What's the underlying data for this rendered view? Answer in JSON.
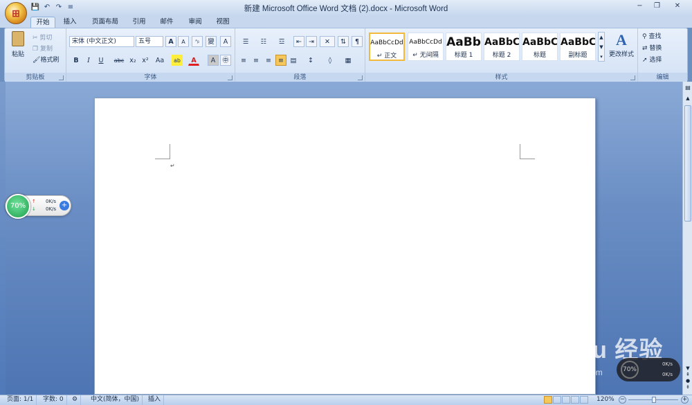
{
  "window": {
    "title": "新建 Microsoft Office Word 文档 (2).docx - Microsoft Word",
    "min": "−",
    "restore": "❐",
    "close": "✕"
  },
  "office_button": {
    "glyph": "⊞"
  },
  "qat": [
    "💾",
    "↶",
    "↷",
    "≡"
  ],
  "tabs": [
    "开始",
    "插入",
    "页面布局",
    "引用",
    "邮件",
    "审阅",
    "视图"
  ],
  "clipboard": {
    "paste": "粘贴",
    "cut": "剪切",
    "copy": "复制",
    "format_painter": "格式刷",
    "label": "剪贴板"
  },
  "font": {
    "name": "宋体 (中文正文)",
    "size": "五号",
    "label": "字体",
    "grow": "A",
    "shrink": "A",
    "clear": "ᴬᵦ",
    "phonetic": "變",
    "border": "A",
    "bold": "B",
    "italic": "I",
    "underline": "U",
    "strike": "abc",
    "sub": "x₂",
    "sup": "x²",
    "case": "Aa",
    "highlight": "ab",
    "color": "A",
    "shade": "A",
    "enclose": "㊥"
  },
  "paragraph": {
    "label": "段落"
  },
  "styles": {
    "label": "样式",
    "items": [
      {
        "preview": "AaBbCcDd",
        "name": "↵ 正文"
      },
      {
        "preview": "AaBbCcDd",
        "name": "↵ 无间隔"
      },
      {
        "preview": "AaBb",
        "name": "标题 1"
      },
      {
        "preview": "AaBbC",
        "name": "标题 2"
      },
      {
        "preview": "AaBbC",
        "name": "标题"
      },
      {
        "preview": "AaBbC",
        "name": "副标题"
      }
    ],
    "change": "更改样式"
  },
  "editing": {
    "label": "编辑",
    "find": "查找",
    "replace": "替换",
    "select": "选择"
  },
  "doc": {
    "para_mark": "↵"
  },
  "status": {
    "page": "页面: 1/1",
    "words": "字数: 0",
    "lang": "中文(简体，中国)",
    "mode": "插入",
    "zoom": "120%"
  },
  "widget1": {
    "percent": "70%",
    "up": "0K/s",
    "down": "0K/s"
  },
  "widget2": {
    "percent": "70%",
    "up": "0K/s",
    "down": "0K/s"
  },
  "watermark": {
    "brand": "Bai du 经验",
    "url": "jingyan.baidu.com"
  }
}
